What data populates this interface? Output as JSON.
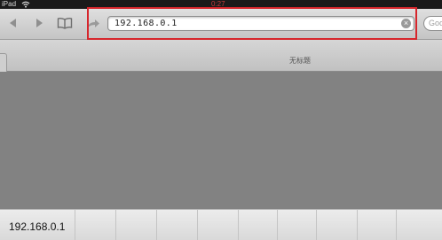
{
  "status_bar": {
    "carrier": "iPad",
    "time": "0:27"
  },
  "toolbar": {
    "url_value": "192.168.0.1",
    "search_placeholder": "Goo",
    "clear_symbol": "×"
  },
  "tab": {
    "title": "无标题"
  },
  "keyboard": {
    "suggestion": "192.168.0.1"
  },
  "colors": {
    "highlight": "#d6262c",
    "content_background": "#818181"
  },
  "icons": [
    "back-icon",
    "forward-icon",
    "bookmarks-icon",
    "share-icon",
    "clear-icon",
    "wifi-icon"
  ]
}
